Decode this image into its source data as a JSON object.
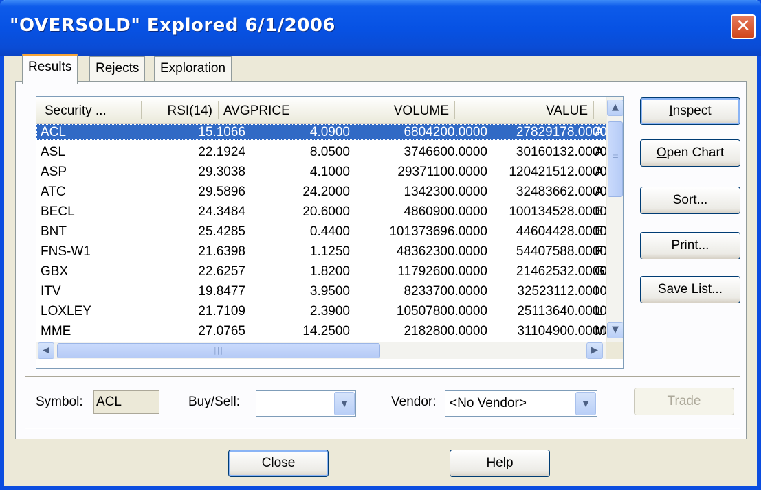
{
  "window": {
    "title": "\"OVERSOLD\" Explored 6/1/2006",
    "close_glyph": "✕"
  },
  "tabs": [
    {
      "label": "Results",
      "active": true
    },
    {
      "label": "Rejects",
      "active": false
    },
    {
      "label": "Exploration",
      "active": false
    }
  ],
  "table": {
    "columns": [
      "Security ...",
      "RSI(14)",
      "AVGPRICE",
      "VOLUME",
      "VALUE"
    ],
    "rows": [
      {
        "security": "ACL",
        "rsi": "15.1066",
        "avgprice": "4.0900",
        "volume": "6804200.0000",
        "value": "27829178.0000",
        "extra": "A",
        "selected": true
      },
      {
        "security": "ASL",
        "rsi": "22.1924",
        "avgprice": "8.0500",
        "volume": "3746600.0000",
        "value": "30160132.0000",
        "extra": "A"
      },
      {
        "security": "ASP",
        "rsi": "29.3038",
        "avgprice": "4.1000",
        "volume": "29371100.0000",
        "value": "120421512.0000",
        "extra": "A"
      },
      {
        "security": "ATC",
        "rsi": "29.5896",
        "avgprice": "24.2000",
        "volume": "1342300.0000",
        "value": "32483662.0000",
        "extra": "A"
      },
      {
        "security": "BECL",
        "rsi": "24.3484",
        "avgprice": "20.6000",
        "volume": "4860900.0000",
        "value": "100134528.0000",
        "extra": "E"
      },
      {
        "security": "BNT",
        "rsi": "25.4285",
        "avgprice": "0.4400",
        "volume": "101373696.0000",
        "value": "44604428.0000",
        "extra": "E"
      },
      {
        "security": "FNS-W1",
        "rsi": "21.6398",
        "avgprice": "1.1250",
        "volume": "48362300.0000",
        "value": "54407588.0000",
        "extra": "F"
      },
      {
        "security": "GBX",
        "rsi": "22.6257",
        "avgprice": "1.8200",
        "volume": "11792600.0000",
        "value": "21462532.0000",
        "extra": "G"
      },
      {
        "security": "ITV",
        "rsi": "19.8477",
        "avgprice": "3.9500",
        "volume": "8233700.0000",
        "value": "32523112.0000",
        "extra": "I"
      },
      {
        "security": "LOXLEY",
        "rsi": "21.7109",
        "avgprice": "2.3900",
        "volume": "10507800.0000",
        "value": "25113640.0000",
        "extra": "L"
      },
      {
        "security": "MME",
        "rsi": "27.0765",
        "avgprice": "14.2500",
        "volume": "2182800.0000",
        "value": "31104900.0000",
        "extra": "M"
      }
    ]
  },
  "scroll": {
    "up": "▲",
    "down": "▼",
    "left": "◀",
    "right": "▶",
    "grip_v": "≡",
    "grip_h": "|||"
  },
  "buttons": {
    "inspect": {
      "pre": "",
      "key": "I",
      "post": "nspect"
    },
    "open_chart": {
      "pre": "",
      "key": "O",
      "post": "pen Chart"
    },
    "sort": {
      "pre": "",
      "key": "S",
      "post": "ort..."
    },
    "print": {
      "pre": "",
      "key": "P",
      "post": "rint..."
    },
    "save_list": {
      "pre": "Save ",
      "key": "L",
      "post": "ist..."
    },
    "trade": {
      "pre": "",
      "key": "T",
      "post": "rade"
    },
    "close": "Close",
    "help": "Help"
  },
  "controls": {
    "symbol_label": "Symbol:",
    "symbol_value": "ACL",
    "buysell_label": "Buy/Sell:",
    "buysell_value": "",
    "vendor_label": "Vendor:",
    "vendor_value": "<No Vendor>",
    "dropdown_glyph": "▼"
  }
}
